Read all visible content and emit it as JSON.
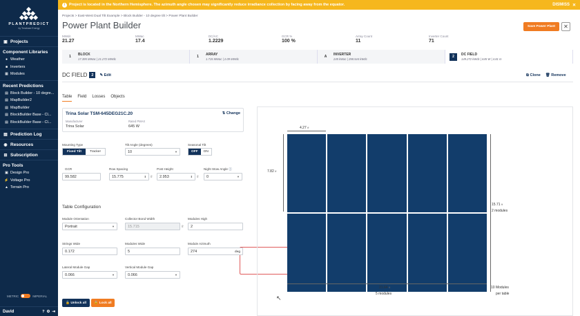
{
  "sidebar": {
    "logo": {
      "name": "PLANTPREDICT",
      "sub": "by Terabase Energy"
    },
    "projects": "Projects",
    "component_libraries": "Component Libraries",
    "libraries": [
      "Weather",
      "Inverters",
      "Modules"
    ],
    "recent_predictions": "Recent Predictions",
    "recent": [
      "Block Builder - 10 degre...",
      "MapBuilder2",
      "MapBuilder",
      "BlockBuilder Base - Cl...",
      "BlockBuilder Base - Cl..."
    ],
    "prediction_log": "Prediction Log",
    "resources": "Resources",
    "subscription": "Subscription",
    "pro_tools": "Pro Tools",
    "tools": [
      "Design Pro",
      "Voltage Pro",
      "Terrain Pro"
    ],
    "units": {
      "metric": "METRIC",
      "imperial": "IMPERIAL"
    },
    "user": "David"
  },
  "banner": {
    "message": "Project is located in the Northern Hemisphere. The azimuth angle chosen may significantly reduce irradiance collection by facing away from the equator.",
    "dismiss": "DISMISS"
  },
  "breadcrumb": "Projects  >  East-West Dual Tilt Example  >  Block Builder - 10 degree tilt  >  Power Plant Builder",
  "title": "Power Plant Builder",
  "save_label": "Save Power Plant",
  "stats": [
    {
      "label": "MWdc",
      "value": "21.27"
    },
    {
      "label": "MWac",
      "value": "17.4"
    },
    {
      "label": "DC/AC",
      "value": "1.2229"
    },
    {
      "label": "GCR %",
      "value": "100 %"
    },
    {
      "label": "Array Count",
      "value": "11"
    },
    {
      "label": "Inverter Count",
      "value": "71"
    }
  ],
  "steps": [
    {
      "num": "1",
      "name": "BLOCK",
      "sub": "17.395 MWac | 21.272 MWdc"
    },
    {
      "num": "1",
      "name": "ARRAY",
      "sub": "1.715 MWac | 2.09 MWdc"
    },
    {
      "num": "A",
      "name": "INVERTER",
      "sub": "245 kWac | 298.544 kWdc"
    },
    {
      "num": "2",
      "name": "DC FIELD",
      "sub": "149.272 kWdc | 645 W | 4.81 m"
    }
  ],
  "dc_field": {
    "title": "DC FIELD",
    "badge": "2",
    "edit": "Edit",
    "clone": "Clone",
    "remove": "Remove"
  },
  "tabs": [
    "Table",
    "Field",
    "Losses",
    "Objects"
  ],
  "module": {
    "name": "Trina Solar TSM-645DEG21C.20",
    "change": "Change",
    "manufacturer_label": "Manufacturer",
    "manufacturer": "Trina Solar",
    "pmax_label": "Rated PMAX",
    "pmax": "645 W"
  },
  "form": {
    "mounting_type": {
      "label": "Mounting Type",
      "options": [
        "Fixed Tilt",
        "Tracker"
      ]
    },
    "tilt_angle": {
      "label": "Tilt Angle (degrees)",
      "value": "10"
    },
    "seasonal_tilt": {
      "label": "Seasonal Tilt",
      "options": [
        "OFF",
        "ON"
      ]
    },
    "gcr": {
      "label": "GCR",
      "value": "99.582"
    },
    "row_spacing": {
      "label": "Row Spacing",
      "value": "15.775",
      "unit": "ft"
    },
    "post_height": {
      "label": "Post Height",
      "value": "2.953",
      "unit": "ft"
    },
    "night_stow": {
      "label": "Night Stow Angle",
      "value": "0"
    }
  },
  "table_config": {
    "title": "Table Configuration",
    "module_orientation": {
      "label": "Module Orientation",
      "value": "Portrait"
    },
    "collector_bond_width": {
      "label": "Collector Bond Width",
      "value": "15.715",
      "unit": "ft"
    },
    "modules_high": {
      "label": "Modules High",
      "value": "2"
    },
    "strings_wide": {
      "label": "Strings Wide",
      "value": "0.172"
    },
    "modules_wide": {
      "label": "Modules Wide",
      "value": "5"
    },
    "module_azimuth": {
      "label": "Module Azimuth",
      "value": "274",
      "unit": "deg"
    },
    "lateral_gap": {
      "label": "Lateral Module Gap",
      "value": "0.066"
    },
    "vertical_gap": {
      "label": "Vertical Module Gap",
      "value": "0.066"
    }
  },
  "buttons": {
    "unlock": "Unlock all",
    "lock": "Lock all"
  },
  "diagram": {
    "module_width": "4.27",
    "module_height": "7.82",
    "table_height": "15.71",
    "table_height_modules": "2 modules",
    "table_width": "21.64",
    "table_width_modules": "5 modules",
    "modules_per_table": "10 Modules",
    "per_table": "per table",
    "unit": "ft"
  }
}
